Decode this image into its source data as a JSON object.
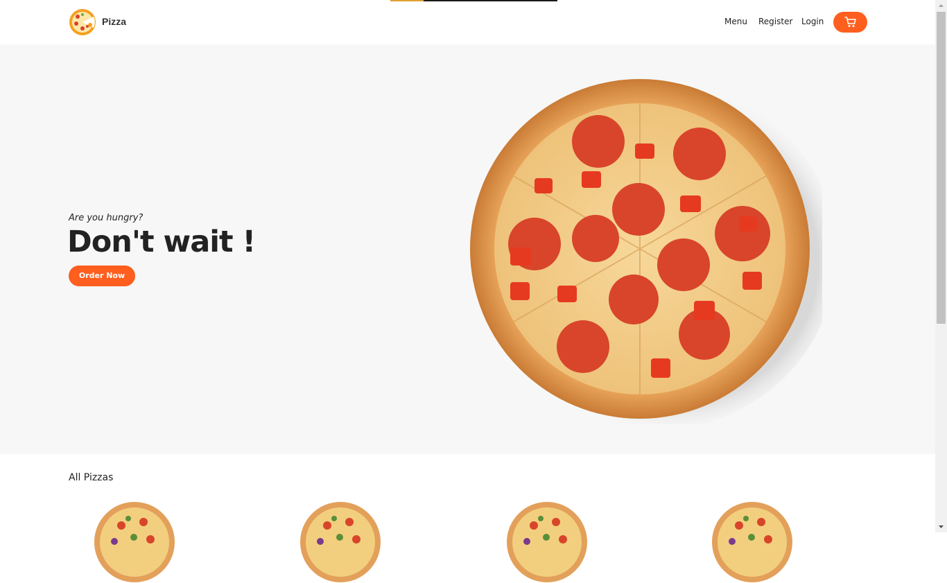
{
  "header": {
    "brand": "Pizza",
    "logo_icon": "pizza-logo-icon",
    "links": [
      {
        "label": "Menu"
      },
      {
        "label": "Register"
      },
      {
        "label": "Login"
      }
    ],
    "cart_icon": "cart-icon",
    "accent_color": "#fe5f1e"
  },
  "hero": {
    "subtitle": "Are you hungry?",
    "title": "Don't wait !",
    "cta_label": "Order Now",
    "image_icon": "pepperoni-pizza-image"
  },
  "section": {
    "title": "All Pizzas",
    "items": [
      {
        "image": "pizza-thumbnail"
      },
      {
        "image": "pizza-thumbnail"
      },
      {
        "image": "pizza-thumbnail"
      },
      {
        "image": "pizza-thumbnail"
      }
    ]
  },
  "page_load_progress": 0.2
}
